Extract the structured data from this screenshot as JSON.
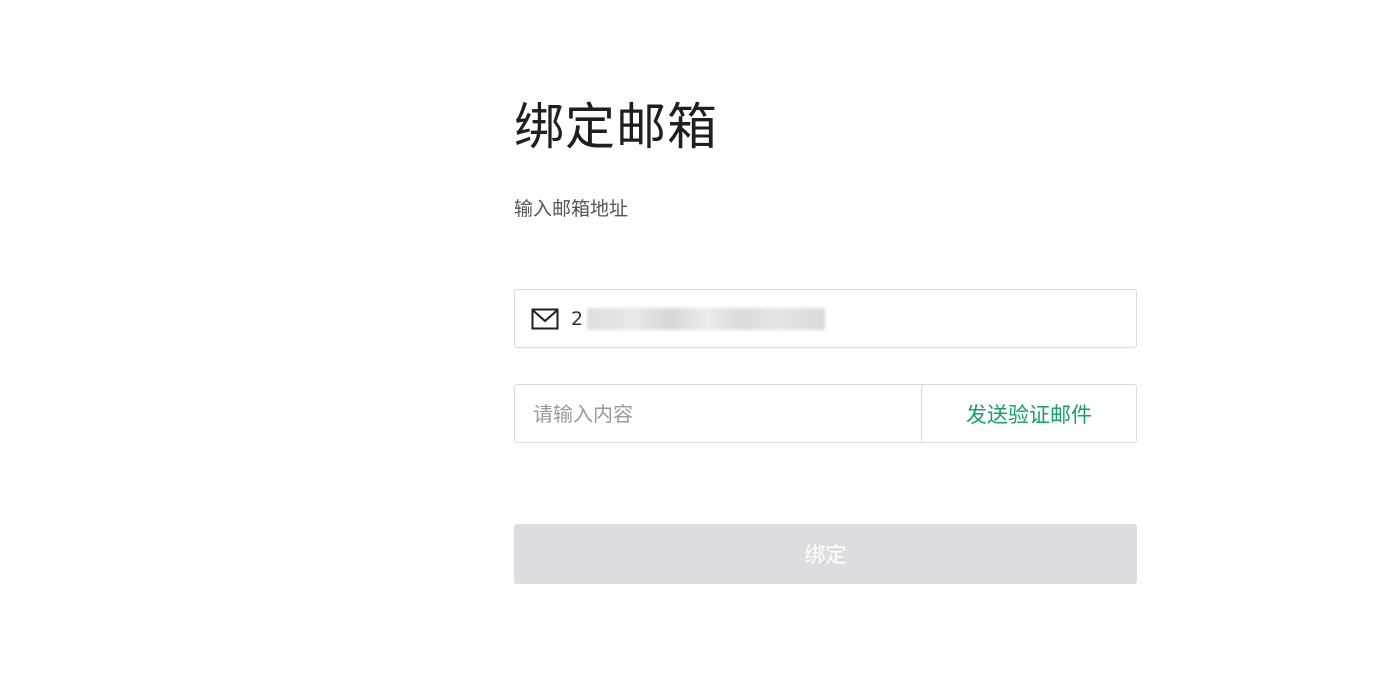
{
  "page": {
    "title": "绑定邮箱",
    "subtitle": "输入邮箱地址"
  },
  "email": {
    "icon": "mail-icon",
    "visible_prefix": "2",
    "value_redacted": true
  },
  "code": {
    "placeholder": "请输入内容",
    "value": ""
  },
  "send_button": {
    "label": "发送验证邮件"
  },
  "bind_button": {
    "label": "绑定",
    "disabled": true
  },
  "colors": {
    "accent": "#13a06a",
    "border": "#d9dce1",
    "disabled_bg": "#dcdde1"
  }
}
